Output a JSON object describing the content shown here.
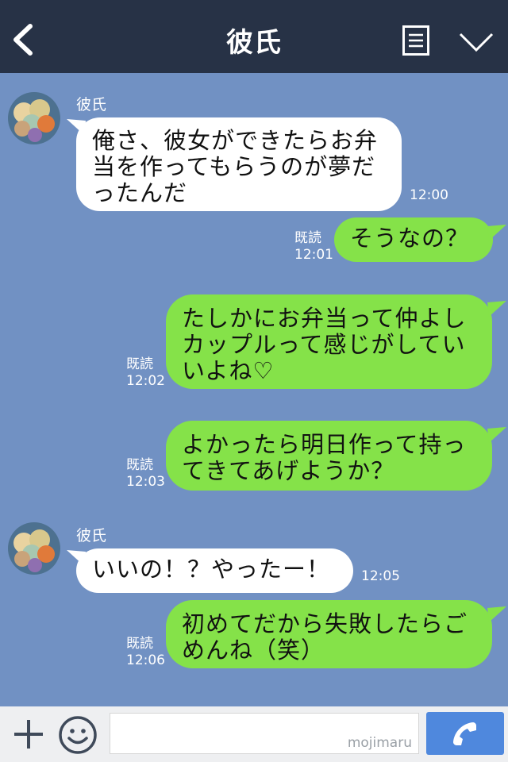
{
  "header": {
    "title": "彼氏",
    "back_icon": "chevron-left-icon",
    "menu_icon": "menu-icon",
    "collapse_icon": "chevron-down-icon",
    "bg_color": "#273246"
  },
  "chat": {
    "bg_color": "#7191c3",
    "incoming_color": "#ffffff",
    "outgoing_color": "#85e249",
    "messages": [
      {
        "dir": "in",
        "sender": "彼氏",
        "text": "俺さ、彼女ができたらお弁\n当を作ってもらうのが夢だ\nったんだ",
        "time": "12:00"
      },
      {
        "dir": "out",
        "read": "既読",
        "text": "そうなの？",
        "time": "12:01"
      },
      {
        "dir": "out",
        "read": "既読",
        "text": "たしかにお弁当って仲よし\nカップルって感じがしてい\nいよね♡",
        "time": "12:02"
      },
      {
        "dir": "out",
        "read": "既読",
        "text": "よかったら明日作って持っ\nてきてあげようか？",
        "time": "12:03"
      },
      {
        "dir": "in",
        "sender": "彼氏",
        "text": "いいの！？やったー！",
        "time": "12:05"
      },
      {
        "dir": "out",
        "read": "既読",
        "text": "初めてだから失敗したらご\nめんね（笑）",
        "time": "12:06"
      }
    ]
  },
  "footer": {
    "watermark": "mojimaru",
    "add_icon": "plus-icon",
    "emoji_icon": "smile-icon",
    "call_icon": "phone-icon",
    "call_color": "#4f88dd"
  }
}
